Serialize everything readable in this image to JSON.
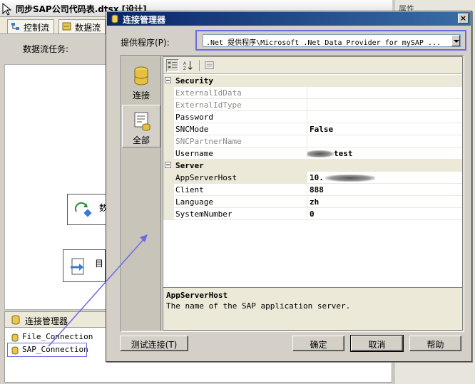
{
  "background": {
    "window_title": "同步SAP公司代码表.dtsx [设计]",
    "tabs": [
      {
        "label": "控制流"
      },
      {
        "label": "数据流"
      }
    ],
    "task_label": "数据流任务:",
    "nodes": [
      {
        "label": "数"
      },
      {
        "label": "目"
      }
    ],
    "connection_panel": {
      "title": "连接管理器",
      "items": [
        {
          "label": "File_Connection"
        },
        {
          "label": "SAP_Connection"
        }
      ]
    },
    "right_panel_title": "属性"
  },
  "dialog": {
    "title": "连接管理器",
    "close_glyph": "×",
    "provider_label": "提供程序(P):",
    "provider_value": ".Net 提供程序\\Microsoft .Net Data Provider for mySAP ...",
    "side_buttons": [
      {
        "label": "连接"
      },
      {
        "label": "全部"
      }
    ],
    "categories": [
      {
        "name": "Security",
        "properties": [
          {
            "name": "ExternalIdData",
            "value": "",
            "disabled": true
          },
          {
            "name": "ExternalIdType",
            "value": "",
            "disabled": true
          },
          {
            "name": "Password",
            "value": "",
            "disabled": false
          },
          {
            "name": "SNCMode",
            "value": "False",
            "disabled": false
          },
          {
            "name": "SNCPartnerName",
            "value": "",
            "disabled": true
          },
          {
            "name": "Username",
            "value": "test",
            "disabled": false
          }
        ]
      },
      {
        "name": "Server",
        "properties": [
          {
            "name": "AppServerHost",
            "value": "10.",
            "disabled": false
          },
          {
            "name": "Client",
            "value": "888",
            "disabled": false
          },
          {
            "name": "Language",
            "value": "zh",
            "disabled": false
          },
          {
            "name": "SystemNumber",
            "value": "0",
            "disabled": false
          }
        ]
      }
    ],
    "description": {
      "title": "AppServerHost",
      "text": "The name of the SAP application server."
    },
    "buttons": {
      "test": "测试连接(T)",
      "ok": "确定",
      "cancel": "取消",
      "help": "帮助"
    }
  }
}
